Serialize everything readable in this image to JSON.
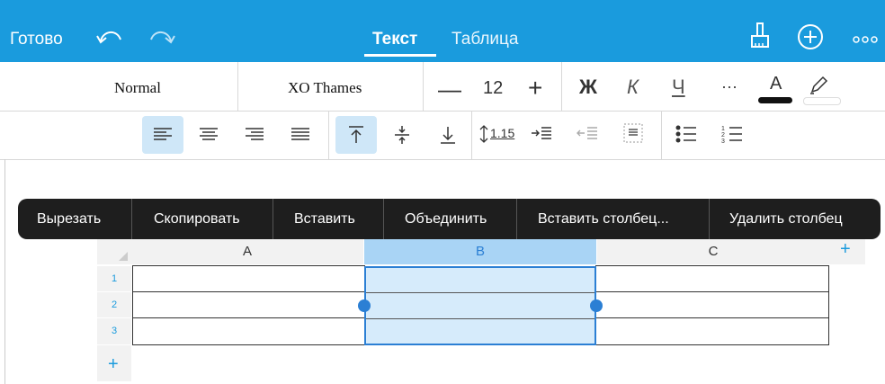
{
  "toolbar": {
    "done": "Готово",
    "tabs": [
      {
        "label": "Текст",
        "active": true
      },
      {
        "label": "Таблица",
        "active": false
      }
    ],
    "accent": "#1a9bdd"
  },
  "format": {
    "paragraph_style": "Normal",
    "font": "XO Thames",
    "font_size": "12",
    "bold": "Ж",
    "italic": "К",
    "underline": "Ч",
    "more": "···",
    "font_color_letter": "А",
    "line_spacing": "1.15"
  },
  "context_menu": {
    "items": [
      "Вырезать",
      "Скопировать",
      "Вставить",
      "Объединить",
      "Вставить столбец...",
      "Удалить столбец"
    ]
  },
  "table": {
    "columns": [
      "A",
      "B",
      "C"
    ],
    "rows": [
      "1",
      "2",
      "3"
    ],
    "add_column": "+",
    "add_row": "+"
  }
}
